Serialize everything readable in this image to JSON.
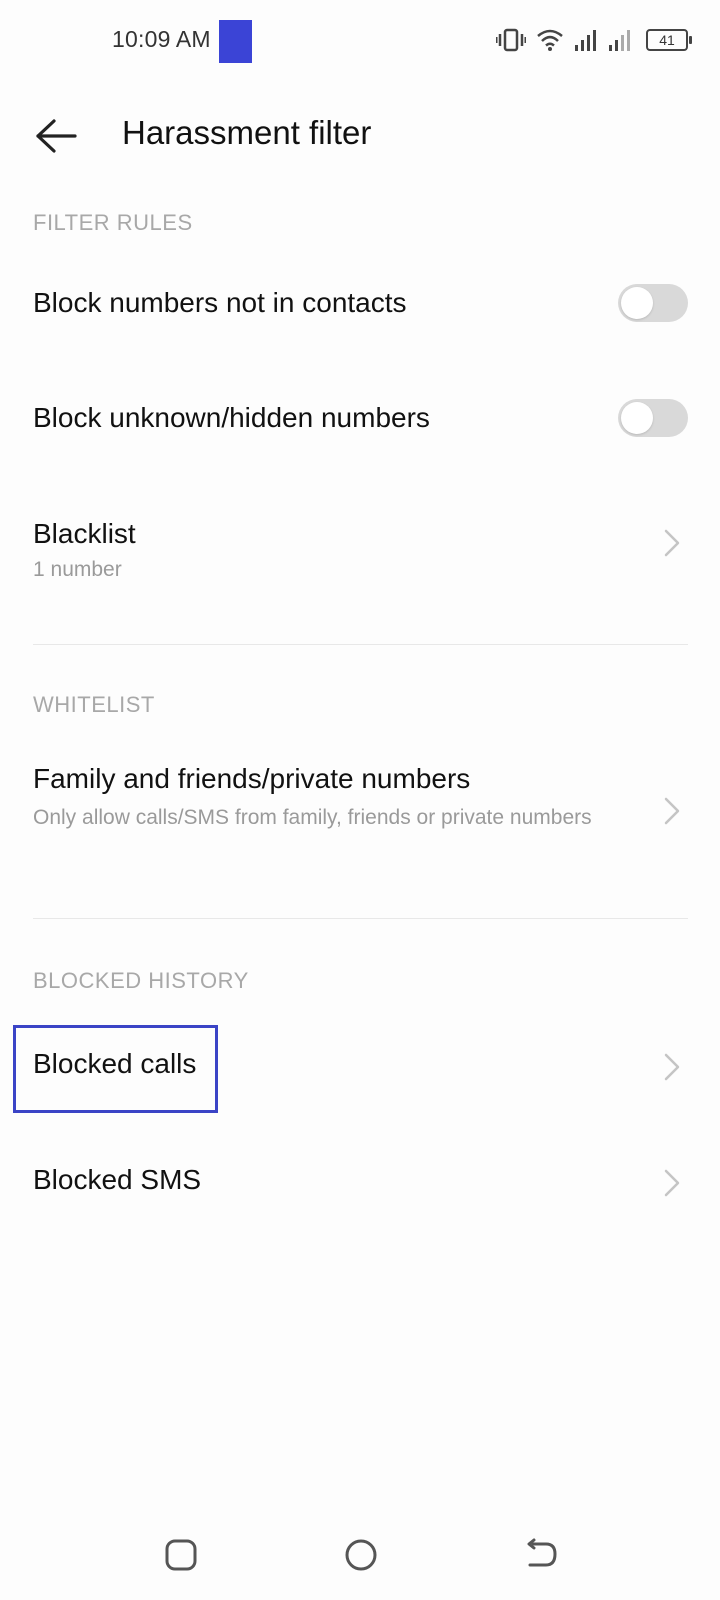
{
  "status_bar": {
    "time": "10:09 AM",
    "battery": "41",
    "notif_color": "#3b44d6",
    "icons": [
      "vibrate-icon",
      "wifi-icon",
      "signal-icon",
      "signal-2-icon",
      "battery-icon"
    ]
  },
  "header": {
    "title": "Harassment filter",
    "back_icon": "arrow-left-icon"
  },
  "filter_rules": {
    "label": "FILTER RULES",
    "items": [
      {
        "title": "Block numbers not in contacts",
        "toggle": false
      },
      {
        "title": "Block unknown/hidden numbers",
        "toggle": false
      }
    ],
    "blacklist": {
      "title": "Blacklist",
      "subtitle": "1 number"
    }
  },
  "whitelist": {
    "label": "WHITELIST",
    "item": {
      "title": "Family and friends/private numbers",
      "subtitle": "Only allow calls/SMS from family, friends or private numbers"
    }
  },
  "blocked_history": {
    "label": "BLOCKED HISTORY",
    "items": [
      {
        "title": "Blocked calls"
      },
      {
        "title": "Blocked SMS"
      }
    ]
  },
  "nav_bar": {
    "icons": [
      "recents-icon",
      "home-icon",
      "back-icon"
    ]
  },
  "colors": {
    "highlight": "#3b44c6",
    "toggle_off": "#d9d9d9",
    "section_label": "#a8a8a8"
  }
}
